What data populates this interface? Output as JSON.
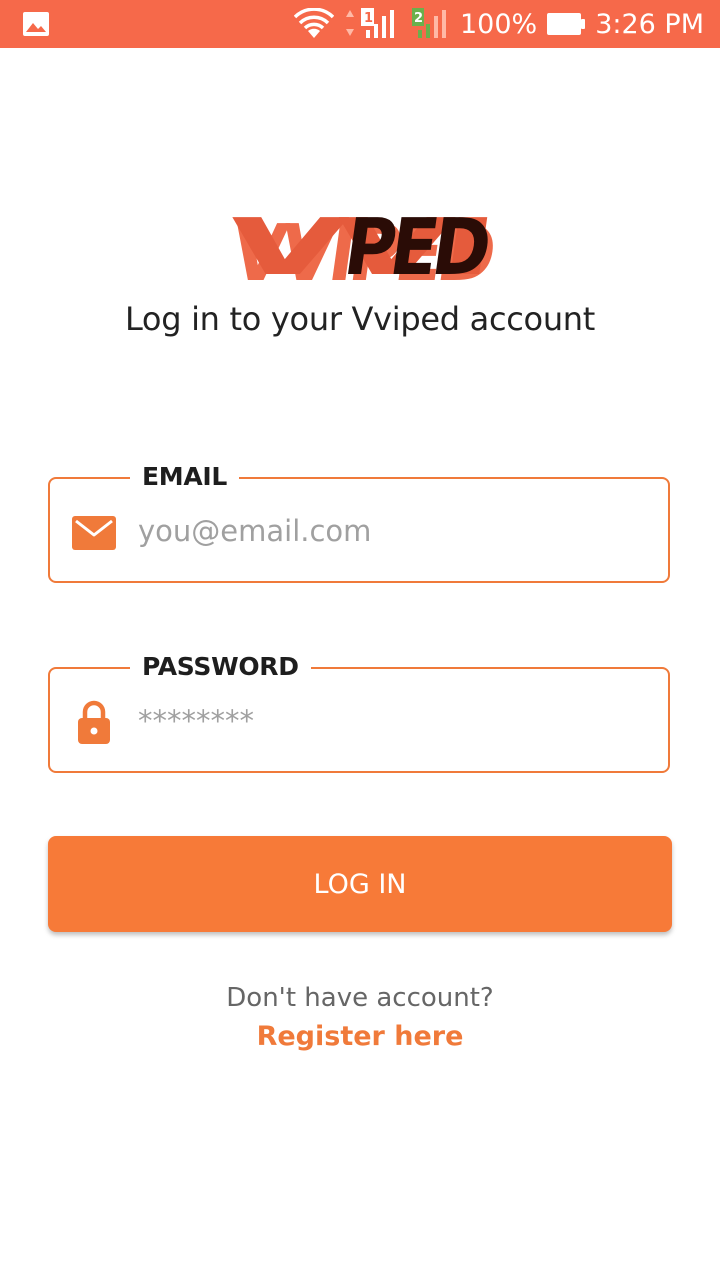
{
  "status_bar": {
    "battery": "100%",
    "time": "3:26 PM",
    "icons": [
      "gallery-icon",
      "wifi-icon",
      "signal-icon-sim1",
      "signal-icon-sim2",
      "battery-icon"
    ]
  },
  "logo": {
    "text": "VVIPED"
  },
  "header": {
    "subtitle": "Log in to your Vviped account"
  },
  "form": {
    "email": {
      "label": "EMAIL",
      "placeholder": "you@email.com",
      "value": "",
      "icon": "mail-icon"
    },
    "password": {
      "label": "PASSWORD",
      "placeholder": "********",
      "value": "",
      "icon": "lock-icon"
    },
    "submit_label": "LOG IN"
  },
  "footer": {
    "prompt": "Don't have account?",
    "register_label": "Register here"
  },
  "colors": {
    "status_bar": "#f6694a",
    "accent": "#f77a38",
    "field_border": "#f07a3a",
    "logo_dark": "#2a0c06"
  }
}
